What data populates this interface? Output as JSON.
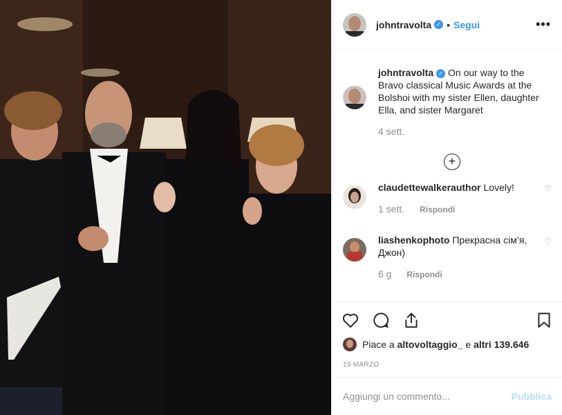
{
  "post": {
    "username": "johntravolta",
    "follow_label": "Segui",
    "more_label": "•••",
    "caption_text": "On our way to the Bravo classical Music Awards at the Bolshoi with my sister Ellen, daughter Ella, and sister Margaret",
    "caption_time": "4 sett.",
    "plus_label": "+"
  },
  "comments": [
    {
      "username": "claudettewalkerauthor",
      "text": "Lovely!",
      "time": "1 sett.",
      "reply_label": "Rispondi"
    },
    {
      "username": "liashenkophoto",
      "text": "Прекрасна сім’я, Джон)",
      "time": "6 g",
      "reply_label": "Rispondi"
    }
  ],
  "likes": {
    "prefix": "Piace a",
    "user": "altovoltaggio_",
    "middle": "e",
    "count_text": "altri 139.646"
  },
  "date": "19 MARZO",
  "add_comment": {
    "placeholder": "Aggiungi un commento...",
    "publish_label": "Pubblica"
  },
  "colors": {
    "link": "#3897f0",
    "publish_disabled": "#b2dffc",
    "muted": "#8e8e8e"
  },
  "icons": [
    "heart-icon",
    "comment-icon",
    "share-icon",
    "bookmark-icon",
    "verified-icon",
    "plus-circle-icon",
    "more-icon"
  ]
}
